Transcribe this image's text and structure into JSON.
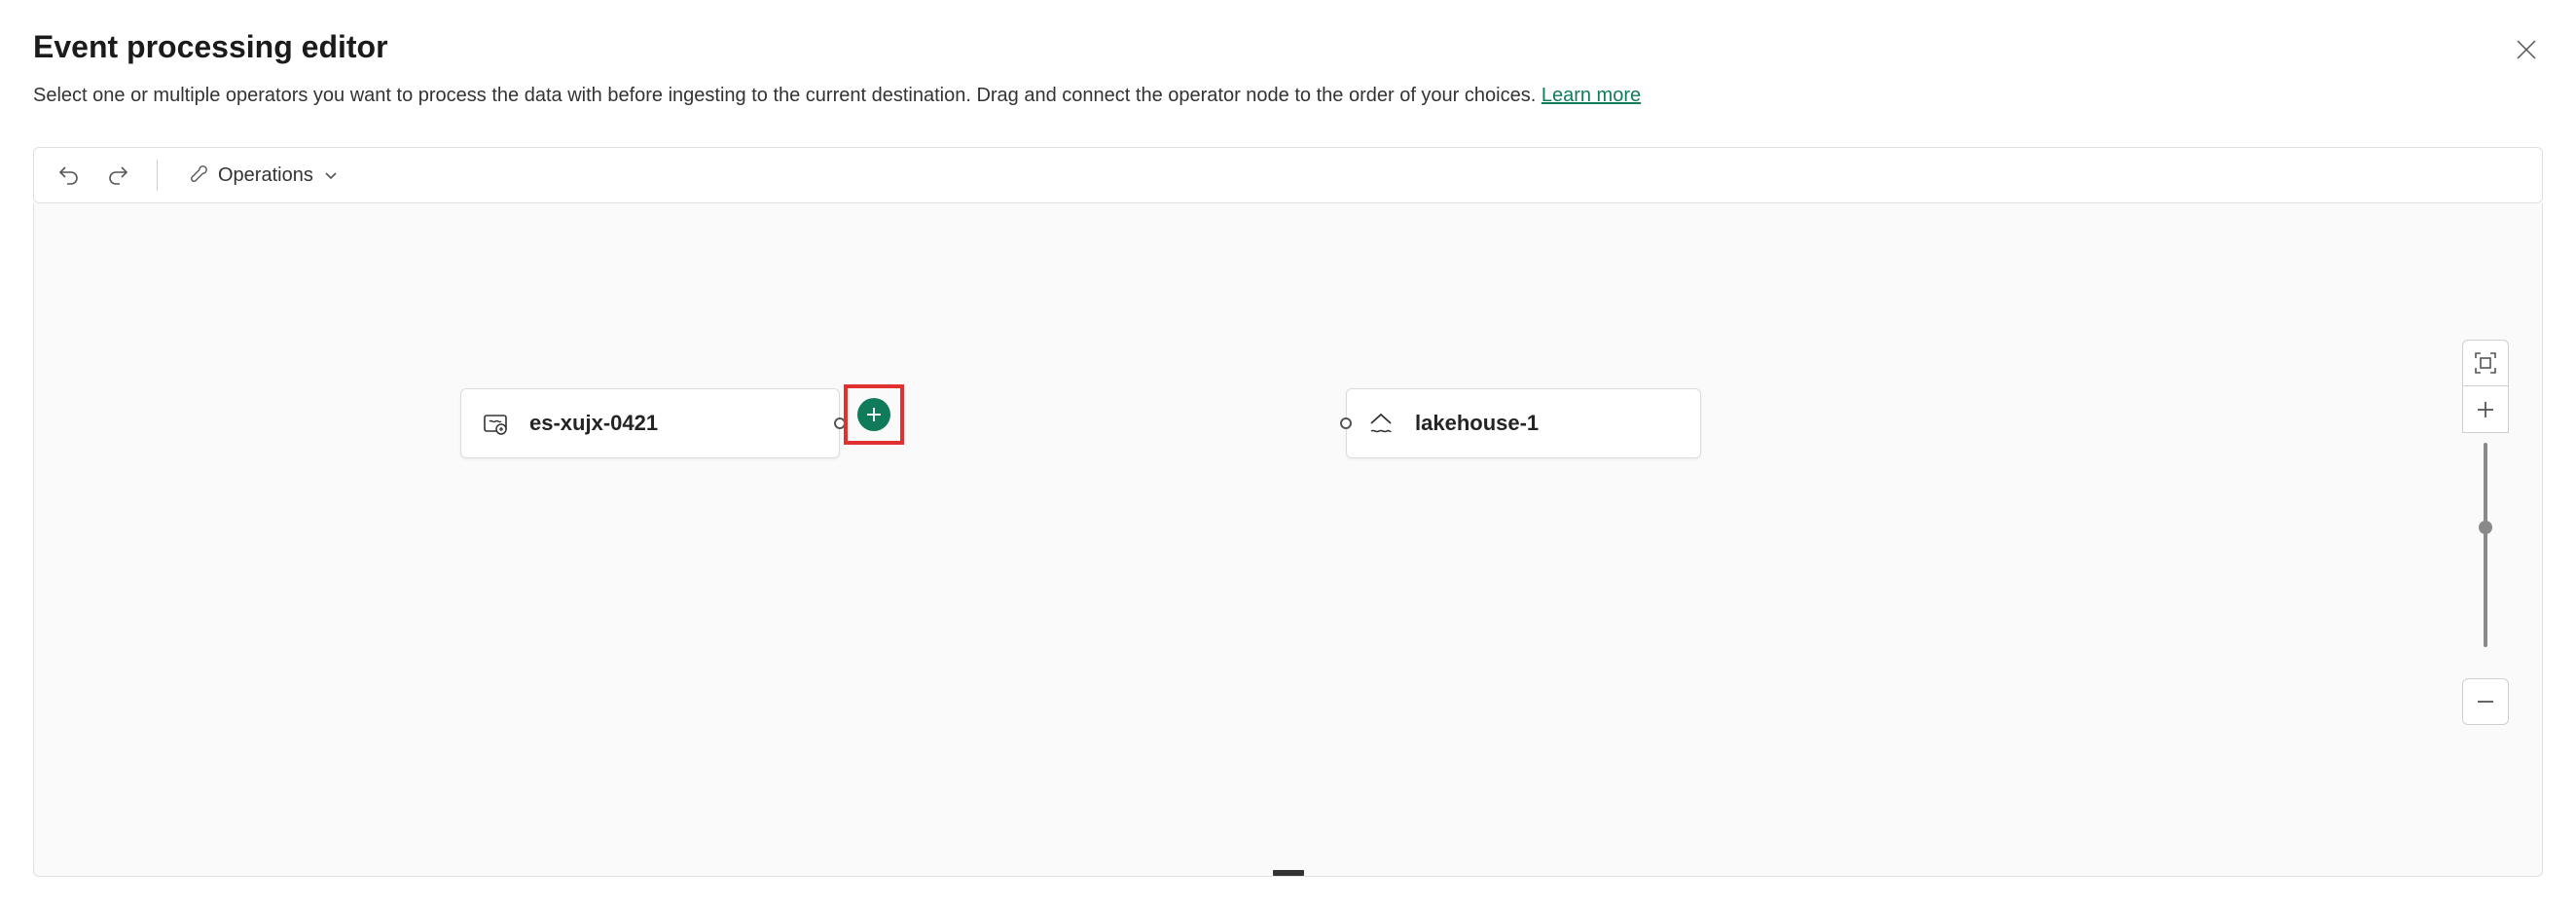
{
  "header": {
    "title": "Event processing editor",
    "subtitle_prefix": "Select one or multiple operators you want to process the data with before ingesting to the current destination. Drag and connect the operator node to the order of your choices. ",
    "learn_more": "Learn more"
  },
  "toolbar": {
    "undo_icon": "undo",
    "redo_icon": "redo",
    "operations_label": "Operations"
  },
  "nodes": {
    "source": {
      "label": "es-xujx-0421",
      "icon": "event-stream"
    },
    "destination": {
      "label": "lakehouse-1",
      "icon": "lakehouse"
    }
  },
  "zoom": {
    "fit_icon": "fit-to-screen",
    "in_icon": "plus",
    "out_icon": "minus"
  }
}
